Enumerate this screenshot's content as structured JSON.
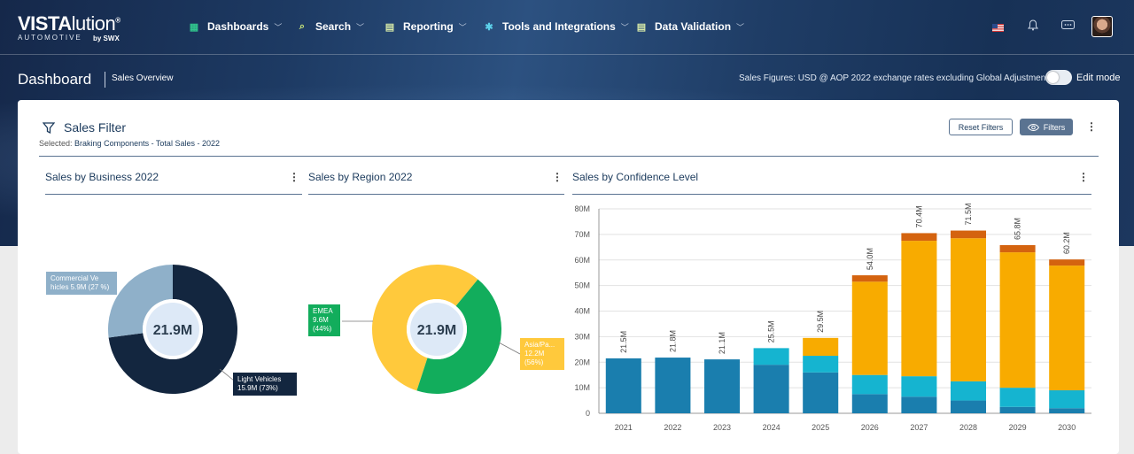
{
  "brand": {
    "name_bold": "VISTA",
    "name_light": "lution",
    "registered": "®",
    "sub": "AUTOMOTIVE",
    "by": "by SWX"
  },
  "nav": {
    "items": [
      {
        "label": "Dashboards",
        "icon": "grid-icon"
      },
      {
        "label": "Search",
        "icon": "search-icon"
      },
      {
        "label": "Reporting",
        "icon": "document-icon"
      },
      {
        "label": "Tools and Integrations",
        "icon": "tools-icon"
      },
      {
        "label": "Data Validation",
        "icon": "checklist-icon"
      }
    ],
    "icons": [
      "us-flag-icon",
      "bell-icon",
      "chat-icon",
      "avatar"
    ]
  },
  "page": {
    "title": "Dashboard",
    "breadcrumb": "Sales Overview",
    "sales_figures": "Sales Figures: USD @ AOP 2022 exchange rates excluding Global Adjustments",
    "edit_mode": "Edit mode"
  },
  "filter": {
    "title": "Sales Filter",
    "selected_label": "Selected:",
    "selected_value": "Braking Components - Total Sales - 2022",
    "reset_button": "Reset Filters",
    "filters_button": "Filters"
  },
  "chart_data": [
    {
      "type": "pie",
      "title": "Sales by Business 2022",
      "center_label": "21.9M",
      "slices": [
        {
          "label": "Commercial Ve hicles 5.9M (27 %)",
          "value": 5.9,
          "percent": 27,
          "color": "#8fb0c9"
        },
        {
          "label": "Light Vehicles 15.9M (73%)",
          "value": 15.9,
          "percent": 73,
          "color": "#13263f"
        }
      ]
    },
    {
      "type": "pie",
      "title": "Sales by Region 2022",
      "center_label": "21.9M",
      "slices": [
        {
          "label": "Asia/Pa... 12.2M (56%)",
          "value": 12.2,
          "percent": 56,
          "color": "#ffc93c"
        },
        {
          "label": "EMEA 9.6M (44%)",
          "value": 9.6,
          "percent": 44,
          "color": "#12ad5c"
        }
      ]
    },
    {
      "type": "bar",
      "stacked": true,
      "title": "Sales by Confidence Level",
      "categories": [
        "2021",
        "2022",
        "2023",
        "2024",
        "2025",
        "2026",
        "2027",
        "2028",
        "2029",
        "2030"
      ],
      "yticks": [
        "0",
        "10M",
        "20M",
        "30M",
        "40M",
        "50M",
        "60M",
        "70M",
        "80M"
      ],
      "ylim": [
        0,
        80
      ],
      "totals": [
        "21.5M",
        "21.8M",
        "21.1M",
        "25.5M",
        "29.5M",
        "54.0M",
        "70.4M",
        "71.5M",
        "65.8M",
        "60.2M"
      ],
      "grid": true,
      "series": [
        {
          "color": "#1a7eae",
          "values": [
            21.5,
            21.8,
            21.1,
            19.0,
            16.0,
            7.5,
            6.5,
            5.0,
            2.5,
            2.0
          ]
        },
        {
          "color": "#15b4d0",
          "values": [
            0,
            0,
            0,
            6.5,
            6.5,
            7.5,
            8.0,
            7.5,
            7.5,
            7.0
          ]
        },
        {
          "color": "#f8ab00",
          "values": [
            0,
            0,
            0,
            0,
            7.0,
            36.5,
            53.0,
            56.0,
            53.0,
            48.8
          ]
        },
        {
          "color": "#d4630f",
          "values": [
            0,
            0,
            0,
            0,
            0,
            2.5,
            3.0,
            3.0,
            2.8,
            2.4
          ]
        }
      ]
    }
  ]
}
